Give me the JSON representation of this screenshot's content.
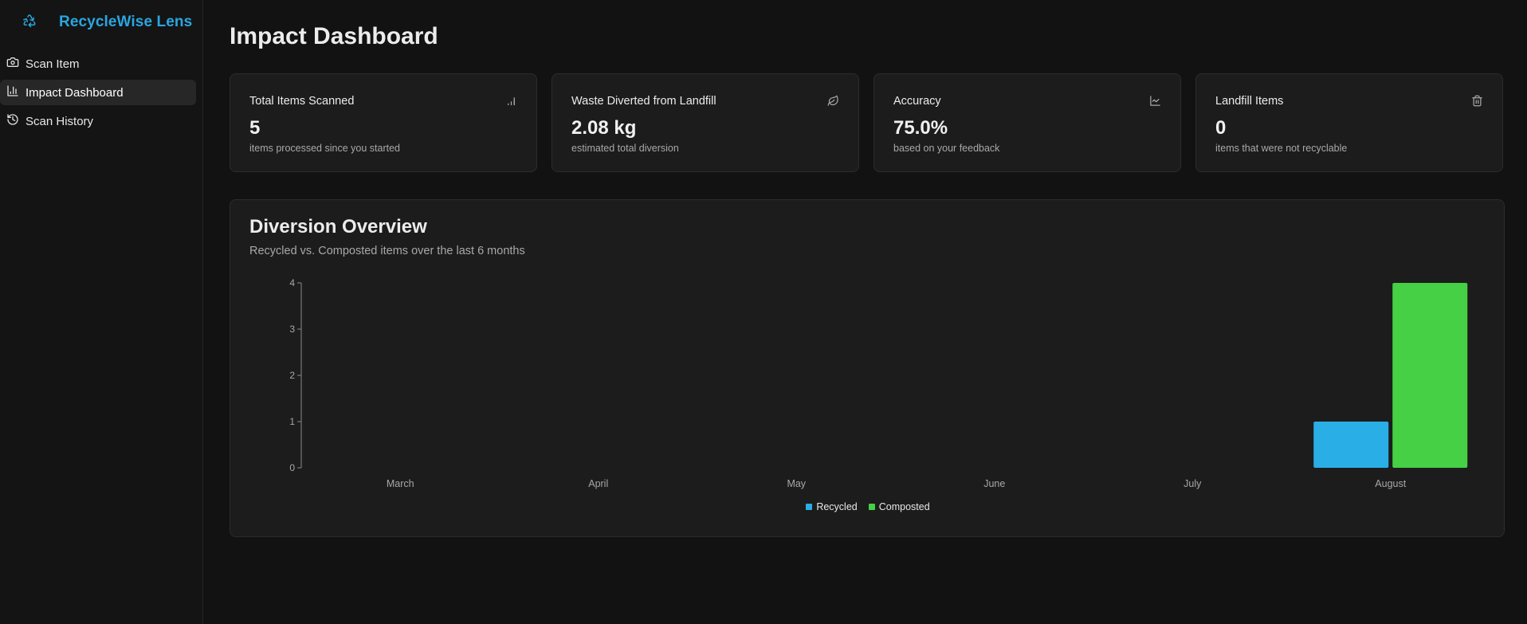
{
  "app": {
    "name": "RecycleWise Lens",
    "brand_color": "#2aa6e0"
  },
  "sidebar": {
    "items": [
      {
        "label": "Scan Item",
        "icon": "camera-icon",
        "active": false
      },
      {
        "label": "Impact Dashboard",
        "icon": "bar-chart-icon",
        "active": true
      },
      {
        "label": "Scan History",
        "icon": "history-icon",
        "active": false
      }
    ]
  },
  "main": {
    "title": "Impact Dashboard"
  },
  "stats": [
    {
      "title": "Total Items Scanned",
      "value": "5",
      "subtitle": "items processed since you started",
      "icon": "bar-chart-icon"
    },
    {
      "title": "Waste Diverted from Landfill",
      "value": "2.08 kg",
      "subtitle": "estimated total diversion",
      "icon": "leaf-icon"
    },
    {
      "title": "Accuracy",
      "value": "75.0%",
      "subtitle": "based on your feedback",
      "icon": "line-chart-icon"
    },
    {
      "title": "Landfill Items",
      "value": "0",
      "subtitle": "items that were not recyclable",
      "icon": "trash-icon"
    }
  ],
  "overview": {
    "title": "Diversion Overview",
    "subtitle": "Recycled vs. Composted items over the last 6 months"
  },
  "chart_data": {
    "type": "bar",
    "categories": [
      "March",
      "April",
      "May",
      "June",
      "July",
      "August"
    ],
    "series": [
      {
        "name": "Recycled",
        "color": "#29aee6",
        "values": [
          0,
          0,
          0,
          0,
          0,
          1
        ]
      },
      {
        "name": "Composted",
        "color": "#45d045",
        "values": [
          0,
          0,
          0,
          0,
          0,
          4
        ]
      }
    ],
    "yticks": [
      "0",
      "1",
      "2",
      "3",
      "4"
    ],
    "ylim": [
      0,
      4
    ],
    "grid": false,
    "legend_position": "bottom-center"
  }
}
